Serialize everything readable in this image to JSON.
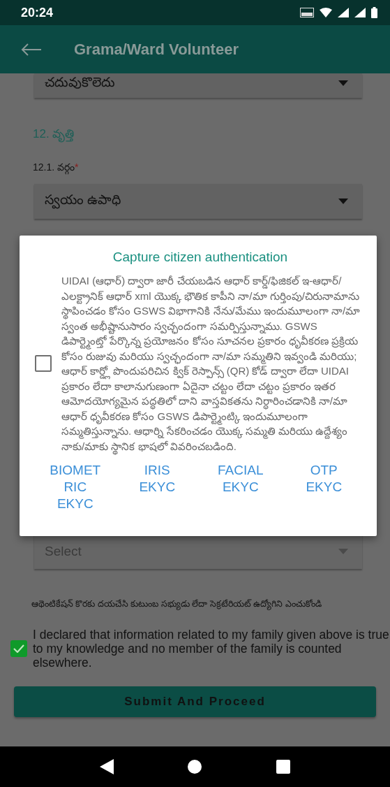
{
  "status_bar": {
    "time": "20:24"
  },
  "app_bar": {
    "title": "Grama/Ward Volunteer"
  },
  "form": {
    "education_dropdown": {
      "value": "చదువుకొలెదు"
    },
    "section_heading": "12. వృత్తి",
    "occupation_label": {
      "text": "12.1. వర్గం",
      "required_mark": "*"
    },
    "occupation_dropdown": {
      "value": "స్వయం ఉపాధి"
    },
    "member_dropdown": {
      "placeholder": "Select"
    },
    "member_note": "ఆథెంటికేషన్ కొరకు దయచేసి కుటుంబ సభ్యుడు లేదా సెక్రటేరియట్ ఉద్యోగిని ఎంచుకోండి",
    "declaration": {
      "text": "I declared that information related to my family given above is true to my knowledge and no member of the family is counted elsewhere.",
      "checked": true
    },
    "submit_button": "Submit And Proceed"
  },
  "dialog": {
    "title": "Capture citizen authentication",
    "consent": {
      "text": "UIDAI (ఆధార్) ద్వారా జారీ చేయబడిన ఆధార్ కార్డ్/ఫిజికల్ ఇ-ఆధార్/ఎలక్ట్రానిక్ ఆధార్ xml యొక్క భౌతిక కాపీని నా/మా గుర్తింపు/చిరునామాను స్థాపించడం కోసం GSWS విభాగానికి నేను/మేము ఇందుమూలంగా నా/మా స్వంత అభీష్టానుసారం స్వచ్ఛందంగా సమర్పిస్తున్నాము. GSWS డిపార్ట్మెంట్తో పేర్కొన్న ప్రయోజనం కోసం సూచనల ప్రకారం ధృవీకరణ ప్రక్రియ కోసం రుజువు మరియు స్వచ్ఛందంగా నా/మా సమ్మతిని ఇవ్వండి మరియు; ఆధార్ కార్డ్లో పొందుపరిచిన క్విక్ రెస్పాన్స్ (QR) కోడ్ ద్వారా లేదా UIDAI ప్రకారం లేదా కాలానుగుణంగా ఏదైనా చట్టం లేదా చట్టం ప్రకారం ఇతర ఆమోదయోగ్యమైన పద్ధతిలో దాని వాస్తవికతను నిర్ధారించడానికి నా/మా ఆధార్ ధృవీకరణ కోసం GSWS డిపార్ట్మెంట్కి ఇందుమూలంగా సమ్మతిస్తున్నాను. ఆధార్ని సేకరించడం యొక్క సమ్మతి మరియు ఉద్దేశ్యం నాకు/మాకు స్థానిక భాషలో వివరించబడింది.",
      "checked": false
    },
    "buttons": [
      "BIOMETRIC EKYC",
      "IRIS EKYC",
      "FACIAL EKYC",
      "OTP EKYC"
    ]
  }
}
